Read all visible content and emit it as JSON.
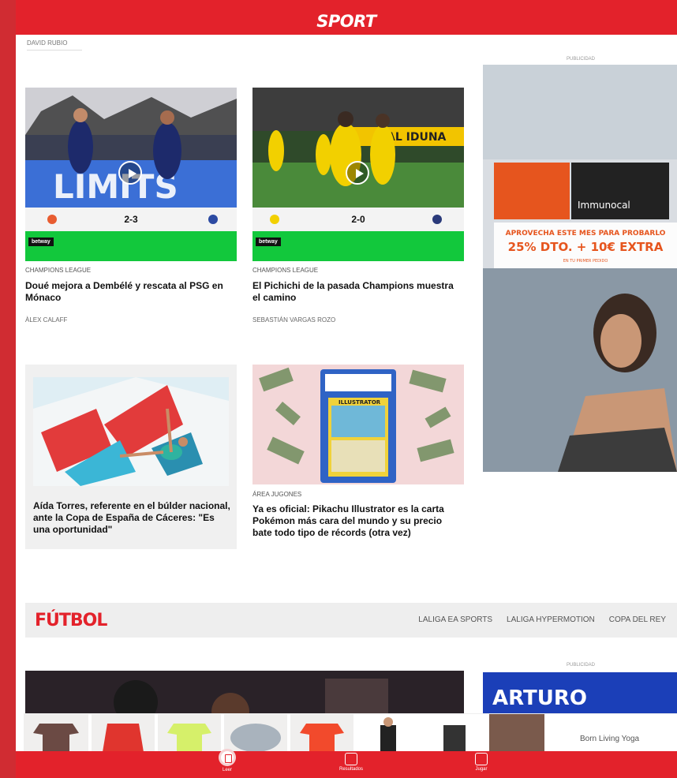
{
  "header": {
    "logo": "SPORT"
  },
  "top_author": "DAVID RUBIO",
  "cards": [
    {
      "category": "CHAMPIONS LEAGUE",
      "title": "Doué mejora a Dembélé y rescata al PSG en Mónaco",
      "author": "ÀLEX CALAFF",
      "score": "2-3",
      "overlay_text": "LIMITS",
      "bet_logo": "betway"
    },
    {
      "category": "CHAMPIONS LEAGUE",
      "title": "El Pichichi de la pasada Champions muestra el camino",
      "author": "SEBASTIÁN VARGAS ROZO",
      "score": "2-0",
      "overlay_text": "AL IDUNA",
      "bet_logo": "betway"
    },
    {
      "category": "",
      "title": "Aída Torres, referente en el búlder nacional, ante la Copa de España de Cáceres: \"Es una oportunidad\"",
      "author": ""
    },
    {
      "category": "ÁREA JUGONES",
      "title": "Ya es oficial: Pikachu Illustrator es la carta Pokémon más cara del mundo y su precio bate todo tipo de récords (otra vez)",
      "author": "",
      "card_label": "ILLUSTRATOR"
    }
  ],
  "ads": {
    "label": "PUBLICIDAD",
    "immunocal": {
      "brand": "Immunocal",
      "line1": "APROVECHA ESTE MES PARA PROBARLO",
      "line2": "25% DTO. + 10€ EXTRA",
      "line3": "EN TU PRIMER PEDIDO"
    },
    "arturo": "ARTURO",
    "bottom_brand": "Born Living Yoga"
  },
  "section": {
    "title": "FÚTBOL",
    "links": [
      "LALIGA EA SPORTS",
      "LALIGA HYPERMOTION",
      "COPA DEL REY"
    ]
  },
  "bottom_nav": [
    {
      "label": "Leer"
    },
    {
      "label": "Resultados"
    },
    {
      "label": "Jugar"
    }
  ],
  "colors": {
    "brand": "#e3222b",
    "bet_green": "#12c83c"
  }
}
